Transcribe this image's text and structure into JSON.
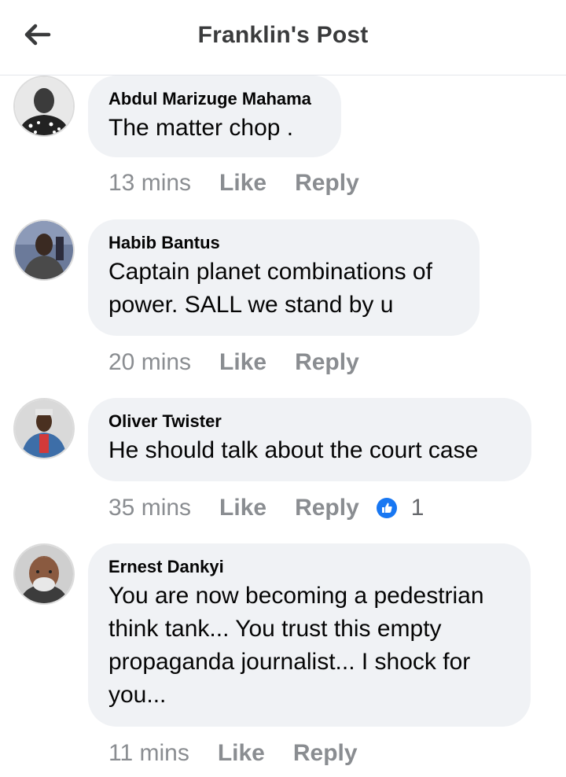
{
  "header": {
    "title": "Franklin's Post",
    "back_icon": "back-arrow-icon"
  },
  "comments": [
    {
      "author": "Abdul Marizuge Mahama",
      "text_lines": [
        "The matter chop ."
      ],
      "time": "13 mins",
      "like_label": "Like",
      "reply_label": "Reply",
      "reactions": null
    },
    {
      "author": "Habib Bantus",
      "text_lines": [
        "Captain planet combinations of",
        "power. SALL we stand by u"
      ],
      "time": "20 mins",
      "like_label": "Like",
      "reply_label": "Reply",
      "reactions": null
    },
    {
      "author": "Oliver Twister",
      "text_lines": [
        "He should talk about the court case"
      ],
      "time": "35 mins",
      "like_label": "Like",
      "reply_label": "Reply",
      "reactions": {
        "icon": "like-reaction-icon",
        "count": "1"
      }
    },
    {
      "author": "Ernest Dankyi",
      "text_lines": [
        "You are now becoming a pedestrian",
        "think tank... You trust this empty",
        "propaganda journalist... I shock for",
        "you..."
      ],
      "time": "11 mins",
      "like_label": "Like",
      "reply_label": "Reply",
      "reactions": null
    }
  ],
  "colors": {
    "bubble_bg": "#f0f2f5",
    "meta_text": "#8a8d91",
    "like_blue": "#1877f2"
  }
}
